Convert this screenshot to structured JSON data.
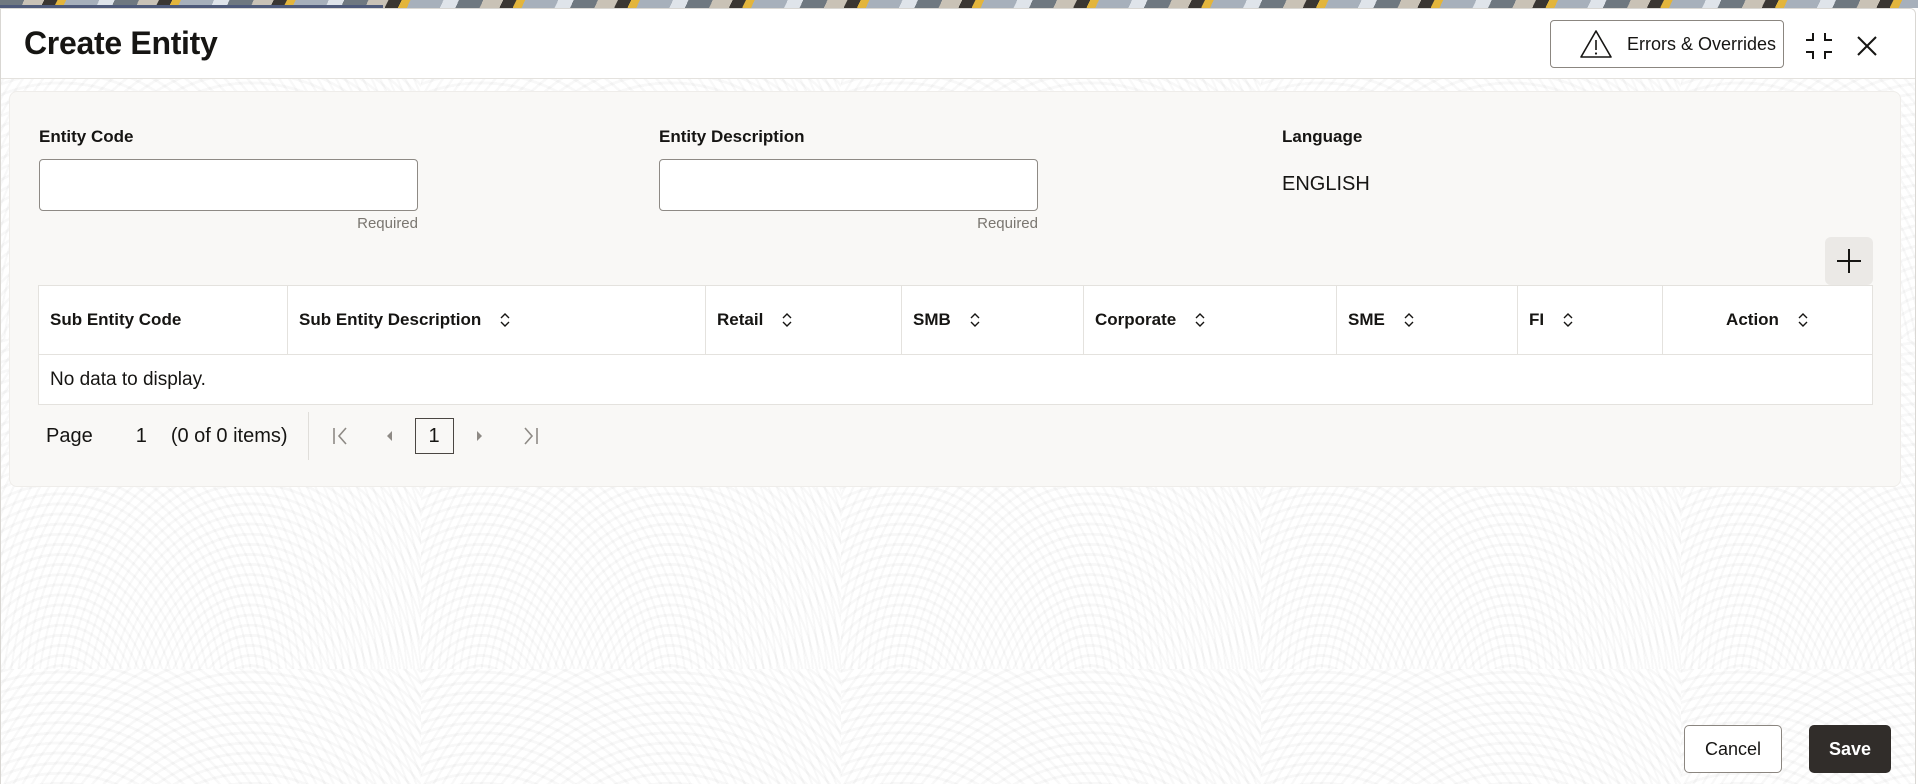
{
  "window": {
    "title": "Create Entity",
    "errors_button_label": "Errors & Overrides"
  },
  "form": {
    "entity_code": {
      "label": "Entity Code",
      "value": "",
      "hint": "Required"
    },
    "entity_description": {
      "label": "Entity Description",
      "value": "",
      "hint": "Required"
    },
    "language": {
      "label": "Language",
      "value": "ENGLISH"
    }
  },
  "grid": {
    "columns": [
      {
        "label": "Sub Entity Code",
        "sortable": false
      },
      {
        "label": "Sub Entity Description",
        "sortable": true
      },
      {
        "label": "Retail",
        "sortable": true
      },
      {
        "label": "SMB",
        "sortable": true
      },
      {
        "label": "Corporate",
        "sortable": true
      },
      {
        "label": "SME",
        "sortable": true
      },
      {
        "label": "FI",
        "sortable": true
      },
      {
        "label": "Action",
        "sortable": true
      }
    ],
    "rows": [],
    "empty_message": "No data to display."
  },
  "pager": {
    "page_label": "Page",
    "current_page": "1",
    "items_summary": "(0 of 0 items)",
    "page_box": "1"
  },
  "footer": {
    "cancel_label": "Cancel",
    "save_label": "Save"
  },
  "icons": {
    "errors": "warning-triangle-icon",
    "compress": "compress-icon",
    "close": "close-icon",
    "add": "plus-icon",
    "sort": "sort-updown-icon",
    "first": "first-page-icon",
    "prev": "prev-page-icon",
    "next": "next-page-icon",
    "last": "last-page-icon"
  },
  "colors": {
    "primary_button": "#312d2a",
    "panel_bg": "#f9f8f6",
    "text": "#161513"
  }
}
